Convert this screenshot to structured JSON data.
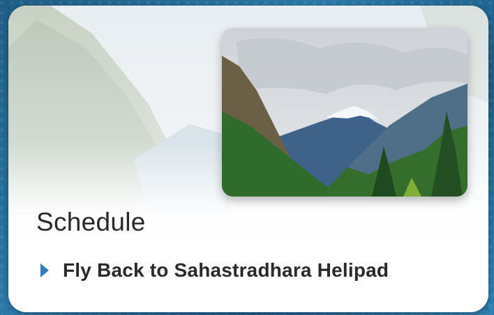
{
  "card": {
    "heading": "Schedule",
    "items": [
      {
        "label": "Fly Back to Sahastradhara Helipad",
        "bullet_color": "#2f7fc2"
      }
    ]
  },
  "colors": {
    "background": "#2b79a8",
    "card": "#ffffff",
    "text": "#2a2a2a"
  }
}
